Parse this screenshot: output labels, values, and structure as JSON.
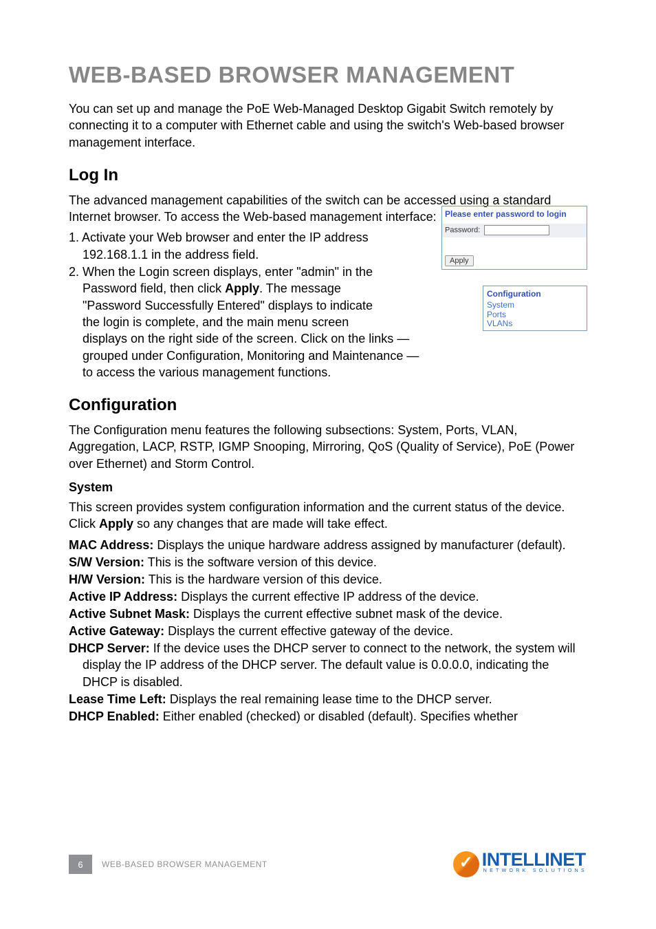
{
  "title": "WEB-BASED BROWSER MANAGEMENT",
  "intro": "You can set up and manage the PoE Web-Managed Desktop Gigabit Switch remotely by connecting it to a computer with Ethernet cable and using the switch's Web-based browser management interface.",
  "sections": {
    "login": {
      "heading": "Log In",
      "para": "The advanced management capabilities of the switch can be accessed using a standard Internet browser. To access the Web-based management interface:",
      "step1_a": "1. Activate your Web browser and enter the IP address ",
      "step1_b": "192.168.1.1 in the address field.",
      "step2_a": "2. When the Login screen displays, enter \"admin\" in the ",
      "step2_b": "Password field, then click ",
      "apply_word": "Apply",
      "step2_c": ". The message ",
      "step2_d": "\"Password Successfully Entered\" displays to indicate ",
      "step2_e": "the login is complete, and the main menu screen ",
      "step2_f": "displays on the right side of the screen. Click on the links — ",
      "step2_g": "grouped under Configuration, Monitoring and Maintenance — ",
      "step2_h": "to access the various management functions."
    },
    "login_panel": {
      "title": "Please enter password to login",
      "label": "Password:",
      "button": "Apply"
    },
    "config_panel": {
      "heading": "Configuration",
      "links": [
        "System",
        "Ports",
        "VLANs"
      ]
    },
    "config": {
      "heading": "Configuration",
      "para": "The Configuration menu features the following subsections: System, Ports, VLAN, Aggregation, LACP, RSTP, IGMP Snooping, Mirroring, QoS (Quality of Service), PoE (Power over Ethernet) and Storm Control.",
      "system_heading": "System",
      "system_para_a": "This screen provides system configuration information and the current status of the device. Click ",
      "apply_word2": "Apply",
      "system_para_b": " so any changes that are made will take effect.",
      "defs": [
        {
          "term": "MAC Address:",
          "desc": " Displays the unique hardware address assigned by manufacturer (default)."
        },
        {
          "term": "S/W Version:",
          "desc": " This is the software version of this device."
        },
        {
          "term": "H/W Version:",
          "desc": " This is the hardware version of this device."
        },
        {
          "term": "Active IP Address:",
          "desc": " Displays the current effective IP address of the device."
        },
        {
          "term": "Active Subnet Mask:",
          "desc": " Displays the current effective subnet mask of the device."
        },
        {
          "term": "Active Gateway:",
          "desc": " Displays the current effective gateway of the device."
        },
        {
          "term": "DHCP Server:",
          "desc": " If the device uses the DHCP server to connect to the network, the system will display the IP address of the DHCP server. The default value is 0.0.0.0, indicating the DHCP is disabled."
        },
        {
          "term": "Lease Time Left:",
          "desc": " Displays the real remaining lease time to the DHCP server."
        },
        {
          "term": "DHCP Enabled:",
          "desc": " Either enabled (checked) or disabled (default). Specifies whether"
        }
      ]
    }
  },
  "footer": {
    "page": "6",
    "label": "WEB-BASED BROWSER MANAGEMENT",
    "logo_text": "INTELLINET",
    "logo_sub": "NETWORK SOLUTIONS"
  }
}
